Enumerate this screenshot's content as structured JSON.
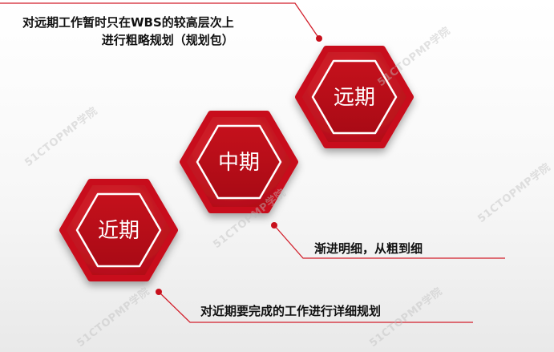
{
  "stages": [
    {
      "id": "near",
      "label": "近期"
    },
    {
      "id": "mid",
      "label": "中期"
    },
    {
      "id": "far",
      "label": "远期"
    }
  ],
  "captions": {
    "far_line1": "对远期工作暂时只在WBS的较高层次上",
    "far_line2": "进行粗略规划（规划包）",
    "mid": "渐进明细，从粗到细",
    "near": "对近期要完成的工作进行详细规划"
  },
  "watermark": "51CTOPMP学院",
  "colors": {
    "hex_outer": "#c8101c",
    "hex_inner": "#b30d18",
    "hex_inner_border": "#ffffff",
    "leader_line": "#d21f2b",
    "text_dark": "#111111",
    "label_text": "#ffffff"
  }
}
